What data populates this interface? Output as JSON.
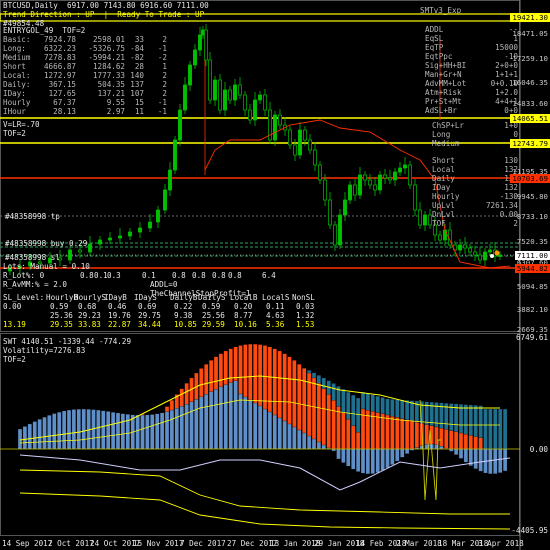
{
  "header": {
    "symbol_line": "BTCUSD,Daily  6917.00 7143.80 6916.60 7111.00",
    "trend_line": "Trend Direction : UP  |  Ready To Trade : UP",
    "id_line": "#49854.48",
    "profile": "ENTRYGOL_49  TOF=2"
  },
  "top_right_label": "SMTv3_Exp",
  "stats_table": {
    "rows": [
      [
        "Basic:",
        "7924.78",
        "2598.01",
        "33",
        "2"
      ],
      [
        "Long:",
        "6322.23",
        "-5326.75",
        "-84",
        "-1"
      ],
      [
        "Medium",
        "7278.83",
        "-5994.21",
        "-82",
        "-2"
      ],
      [
        "Short",
        "4666.87",
        "1284.62",
        "28",
        "1"
      ],
      [
        "Local:",
        "1272.97",
        "1777.33",
        "140",
        "2"
      ],
      [
        "Daily:",
        "367.15",
        "504.35",
        "137",
        "2"
      ],
      [
        "IDay:",
        "127.65",
        "137.21",
        "107",
        "2"
      ],
      [
        "Hourly",
        "67.37",
        "9.55",
        "15",
        "-1"
      ],
      [
        "IHour",
        "28.13",
        "2.97",
        "11",
        "-1"
      ]
    ]
  },
  "lr_block": [
    "V=LR=.70",
    "TOF=2"
  ],
  "right_panel_top": [
    [
      "ADDL",
      "--"
    ],
    [
      "EqSL",
      "1"
    ],
    [
      "EqTP",
      "15000"
    ],
    [
      "EqtPpc",
      "-10"
    ],
    [
      "Sig+HH+BI",
      "2+0+0"
    ],
    [
      "Man+Gr+N",
      "1+1+1"
    ],
    [
      "AdvMM+Lot",
      "0+0.10"
    ],
    [
      "Atm+Risk",
      "1+2.0"
    ],
    [
      "Pr+St+Mt",
      "4+4+1"
    ],
    [
      "AdSL+Br",
      "0+0"
    ]
  ],
  "right_panel_mid": [
    [
      "ChSP+Lr",
      "1+0"
    ],
    [
      "Long",
      "0"
    ],
    [
      "Medium",
      "0"
    ],
    [
      "Short",
      "130"
    ],
    [
      "Local",
      "132"
    ],
    [
      "Daily",
      "132"
    ],
    [
      "IDay",
      "132"
    ],
    [
      "Hourly",
      "-130"
    ],
    [
      "UpLvl",
      "7261.34"
    ],
    [
      "DnLvl",
      "0.00"
    ],
    [
      "TOF",
      "2"
    ]
  ],
  "order_labels": {
    "tp_label": "#48358998 tp",
    "buy_label": "#48358998 buy 0.29",
    "sl_label": "#48358998 sl",
    "lots_line": "Lots: Manual = 0.10",
    "rlot_line": "R_Lot%: 0",
    "ram_line": "R_AvMM:% = 2.0",
    "addl_line": "ADDL=0",
    "channel_line": "TheChannelStopProfit=1",
    "small_nums": [
      "0.8",
      "0.1",
      "0.3",
      "0.1",
      "0.8",
      "0.8",
      "0.8",
      "0.8",
      "6.4"
    ]
  },
  "sl_table": {
    "headers": [
      "SL_Level:",
      "HourlyB",
      "HourlyS",
      "IDayB",
      "IDayS",
      "DailyB",
      "DailyS",
      "LocalB",
      "LocalS",
      "NonSL"
    ],
    "rows": [
      [
        "0.00",
        "0.59",
        "0.68",
        "0.46",
        "0.69",
        "0.22",
        "0.59",
        "0.20",
        "0.11",
        "0.03"
      ],
      [
        "",
        "25.36",
        "29.23",
        "19.76",
        "29.75",
        "9.38",
        "25.56",
        "8.77",
        "4.63",
        "1.32"
      ],
      [
        "13.19",
        "29.35",
        "33.83",
        "22.87",
        "34.44",
        "10.85",
        "29.59",
        "10.16",
        "5.36",
        "1.53"
      ]
    ]
  },
  "price_axis": {
    "labels": [
      "19421.30",
      "18471.05",
      "17259.10",
      "16046.35",
      "14833.60",
      "14065.51",
      "12743.79",
      "11195.35",
      "9945.80",
      "8733.10",
      "7520.35",
      "7111.00",
      "6307.60",
      "5944.82",
      "5094.85",
      "3882.10",
      "2669.35"
    ],
    "highlight": {
      "current": "7111.00",
      "top": "19421.30",
      "mid1": "14065.51",
      "mid2": "12743.79",
      "red1": "10703.69",
      "red2": "5944.82"
    }
  },
  "lower_panel": {
    "title": "SWT 4140.51 -1339.44 -774.29",
    "vol_line": "Volatility=7276.83",
    "tof_line": "TOF=2",
    "axis_labels": [
      "6749.61",
      "0.00",
      "-4405.95"
    ]
  },
  "date_axis": [
    "14 Sep 2017",
    "2 Oct 2017",
    "24 Oct 2017",
    "15 Nov 2017",
    "7 Dec 2017",
    "27 Dec 2017",
    "13 Jan 2018",
    "29 Jan 2018",
    "14 Feb 2018",
    "2 Mar 2018",
    "18 Mar 2018",
    "3 Apr 2018"
  ],
  "colors": {
    "background": "#000000",
    "candle_up": "#00c000",
    "candle_down": "#00c000",
    "yellow_line": "#ffff00",
    "red_line": "#ff3000",
    "orange_fill": "#ff4a10",
    "blue_fill": "#5f8fc8",
    "teal_fill": "#1f6f8f"
  }
}
